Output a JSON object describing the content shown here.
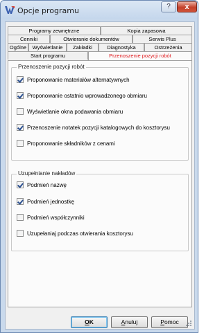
{
  "window": {
    "title": "Opcje programu",
    "help_label": "?",
    "close_label": "x"
  },
  "tabs": {
    "row1": [
      "Programy zewnętrzne",
      "Kopia zapasowa"
    ],
    "row2": [
      "Cenniki",
      "Otwieranie dokumentów",
      "Serwis Plus"
    ],
    "row3": [
      "Ogólne",
      "Wyświetlanie",
      "Zakładki",
      "Diagnostyka",
      "Ostrzeżenia"
    ],
    "row4": [
      "Start programu",
      "Przenoszenie pozycji robót"
    ],
    "active": "Przenoszenie pozycji robót",
    "active_color": "#e0191d"
  },
  "group1": {
    "title": "Przenoszenie pozycji robót",
    "options": [
      {
        "label": "Proponowanie materiałów alternatywnych",
        "checked": true
      },
      {
        "label": "Proponowanie ostatnio wprowadzonego obmiaru",
        "checked": true
      },
      {
        "label": "Wyświetlanie okna podawania obmiaru",
        "checked": false
      },
      {
        "label": "Przenoszenie notatek pozycji katalogowych do kosztorysu",
        "checked": true
      },
      {
        "label": "Proponowanie składników z cenami",
        "checked": false
      }
    ]
  },
  "group2": {
    "title": "Uzupełnianie nakładów",
    "options": [
      {
        "label": "Podmień nazwę",
        "checked": true
      },
      {
        "label": "Podmień jednostkę",
        "checked": true
      },
      {
        "label": "Podmień współczynniki",
        "checked": false
      },
      {
        "label": "Uzupełaniaj podczas otwierania kosztorysu",
        "checked": false
      }
    ]
  },
  "buttons": {
    "ok_hotkey": "O",
    "ok_rest": "K",
    "cancel_hotkey": "A",
    "cancel_rest": "nuluj",
    "help_hotkey": "P",
    "help_rest": "omoc"
  }
}
